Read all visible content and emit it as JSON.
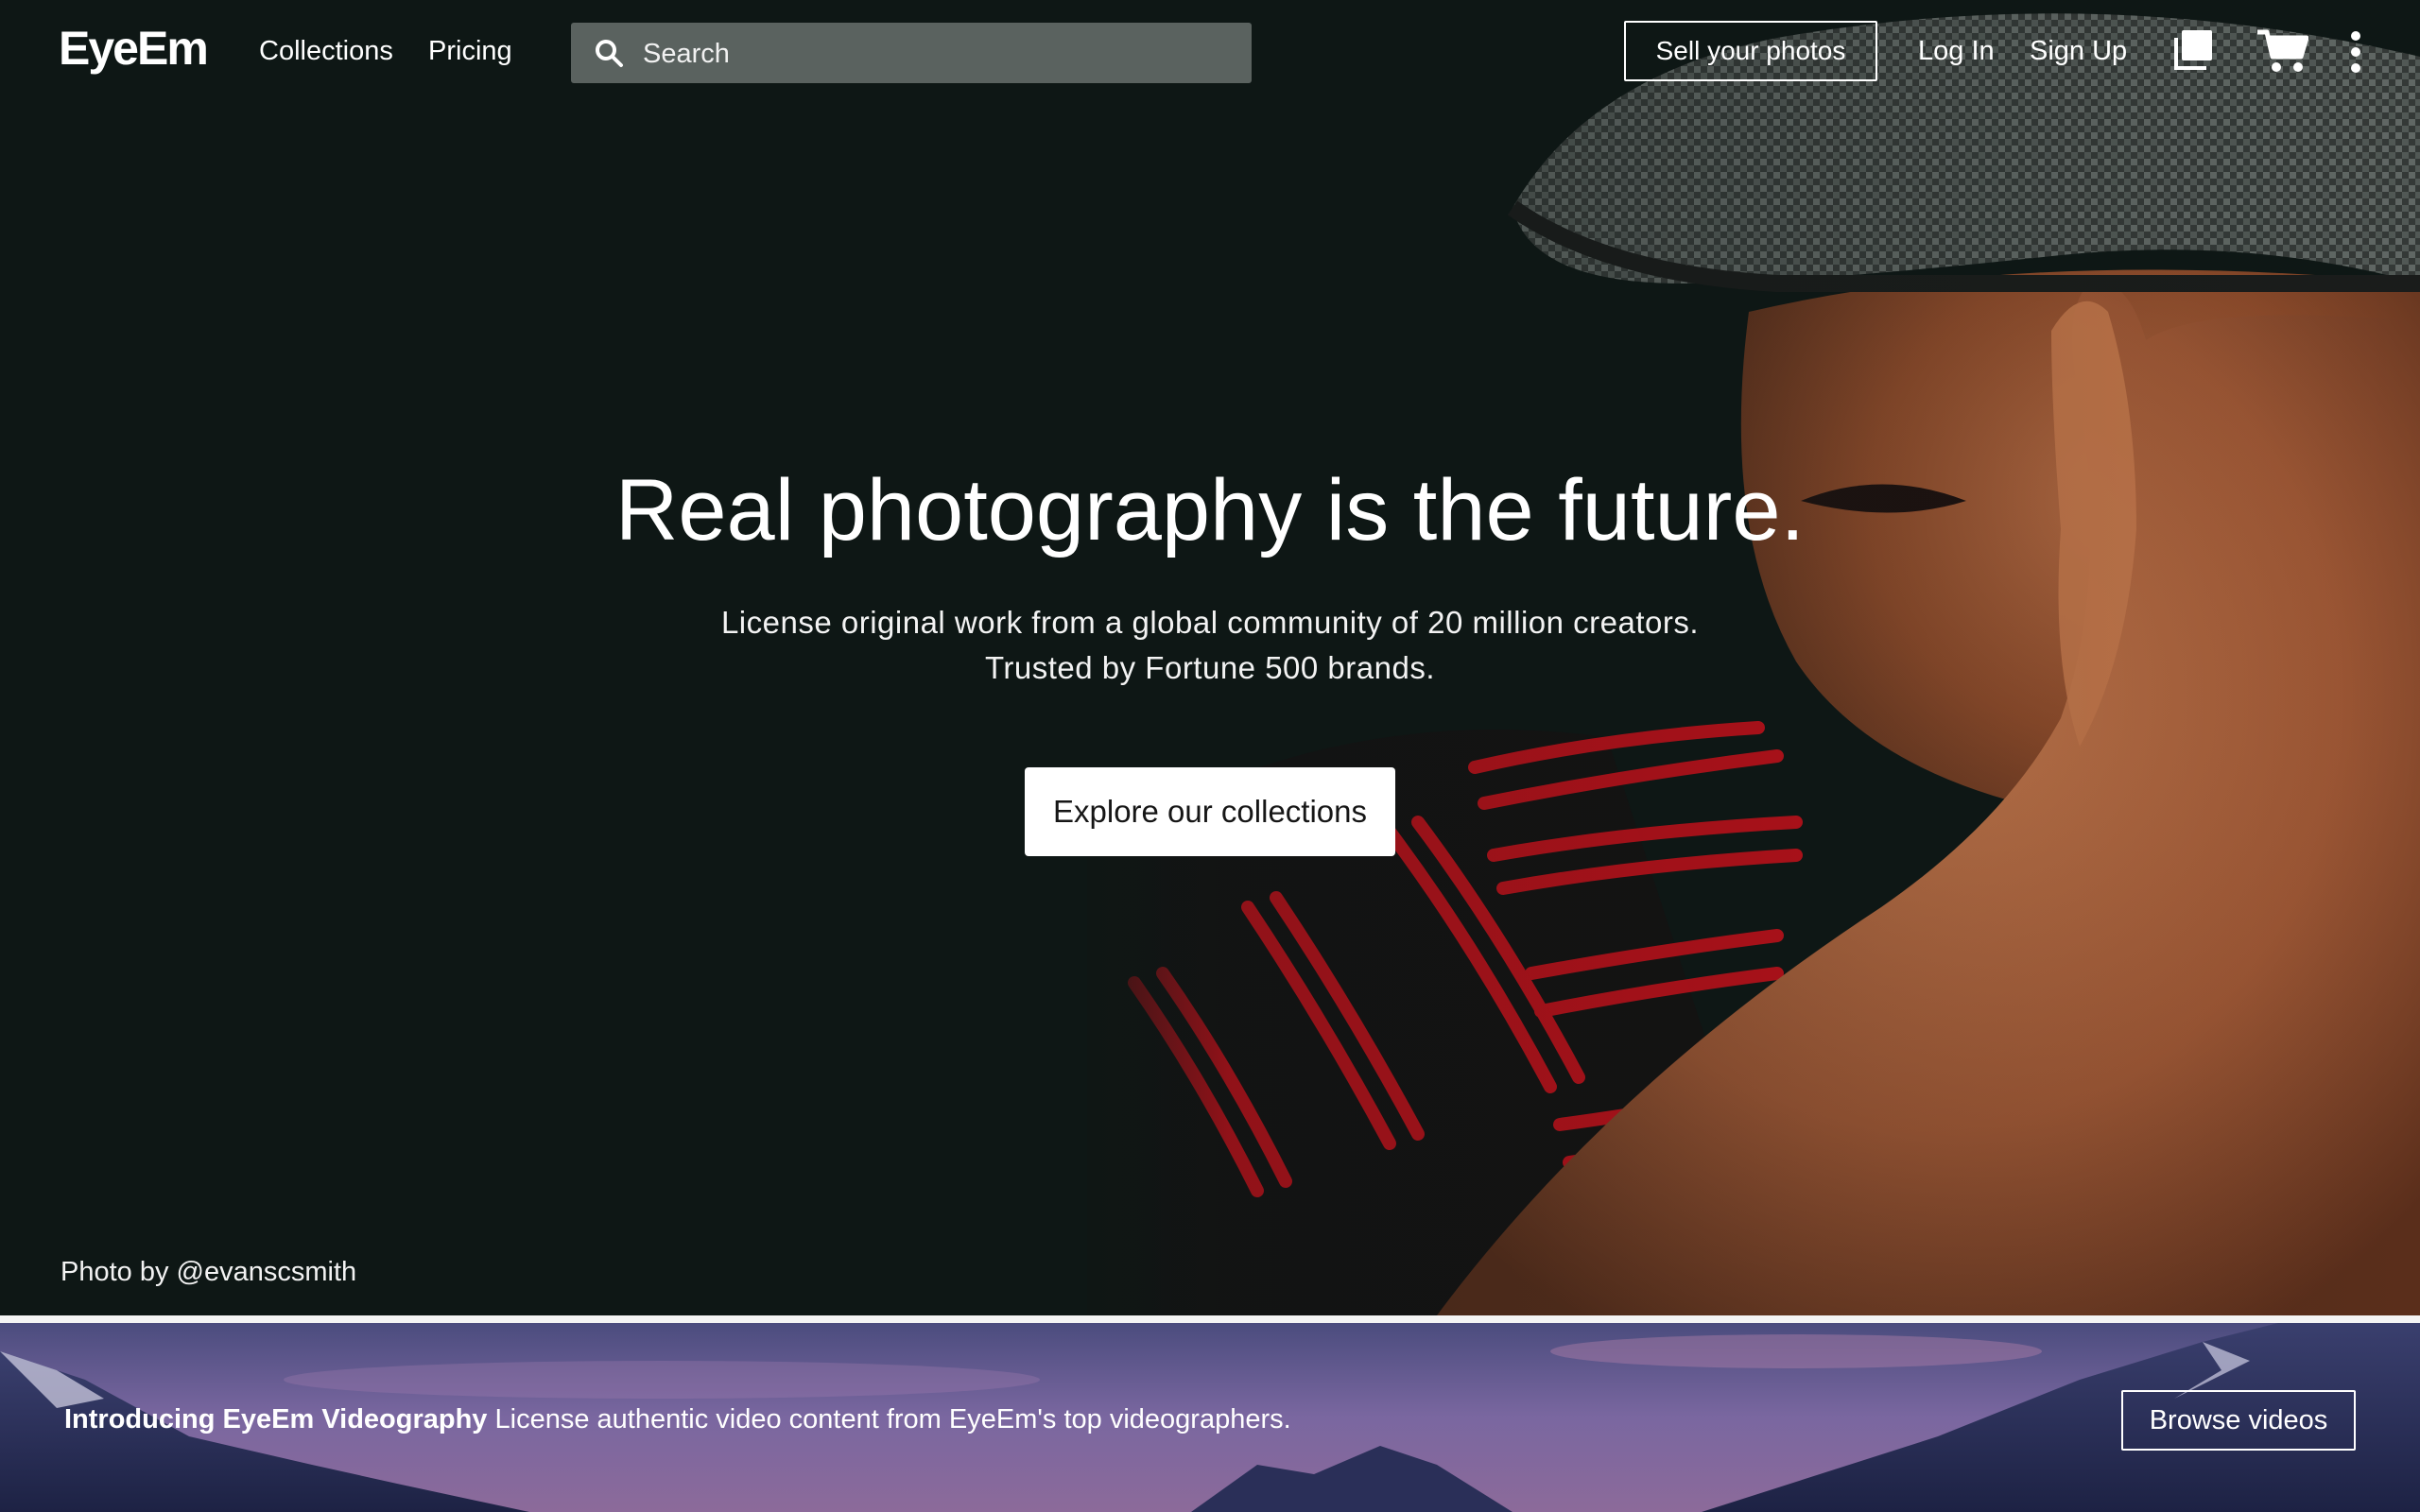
{
  "nav": {
    "logo": "EyeEm",
    "links": [
      "Collections",
      "Pricing"
    ],
    "search_placeholder": "Search",
    "sell_label": "Sell your photos",
    "login_label": "Log In",
    "signup_label": "Sign Up",
    "icons": [
      "lightbox-icon",
      "cart-icon",
      "more-vertical-icon"
    ]
  },
  "hero": {
    "headline": "Real photography is the future.",
    "subline_1": "License original work from a global community of 20 million creators.",
    "subline_2": "Trusted by Fortune 500 brands.",
    "cta_label": "Explore our collections",
    "credit": "Photo by @evanscsmith"
  },
  "banner": {
    "title": "Introducing EyeEm Videography",
    "text": "License authentic video content from EyeEm's top videographers.",
    "button_label": "Browse videos"
  },
  "colors": {
    "background": "#0e1715",
    "search_bg": "#5a625f",
    "accent_red": "#d4101b",
    "skin": "#9a5533",
    "banner_purple": "#6a5a92"
  }
}
